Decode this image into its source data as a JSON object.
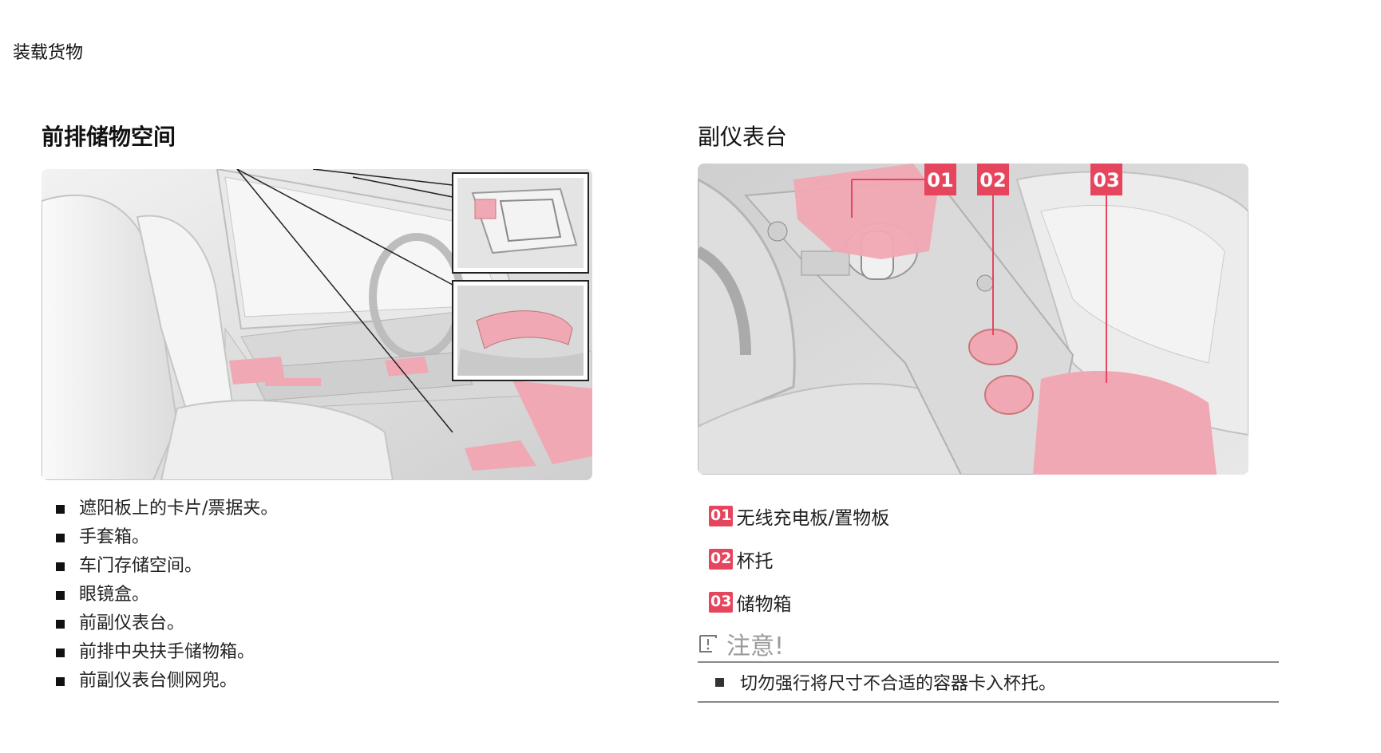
{
  "page_header": "装载货物",
  "left_section": {
    "title": "前排储物空间",
    "items": [
      "遮阳板上的卡片/票据夹。",
      "手套箱。",
      "车门存储空间。",
      "眼镜盒。",
      "前副仪表台。",
      "前排中央扶手储物箱。",
      "前副仪表台侧网兜。"
    ]
  },
  "right_section": {
    "title": "副仪表台",
    "callouts": [
      {
        "num": "01",
        "label": "无线充电板/置物板"
      },
      {
        "num": "02",
        "label": "杯托"
      },
      {
        "num": "03",
        "label": "储物箱"
      }
    ]
  },
  "notice": {
    "title": "注意!",
    "text": "切勿强行将尺寸不合适的容器卡入杯托。"
  },
  "colors": {
    "accent": "#e6455e",
    "highlight": "#f0a8b4"
  }
}
